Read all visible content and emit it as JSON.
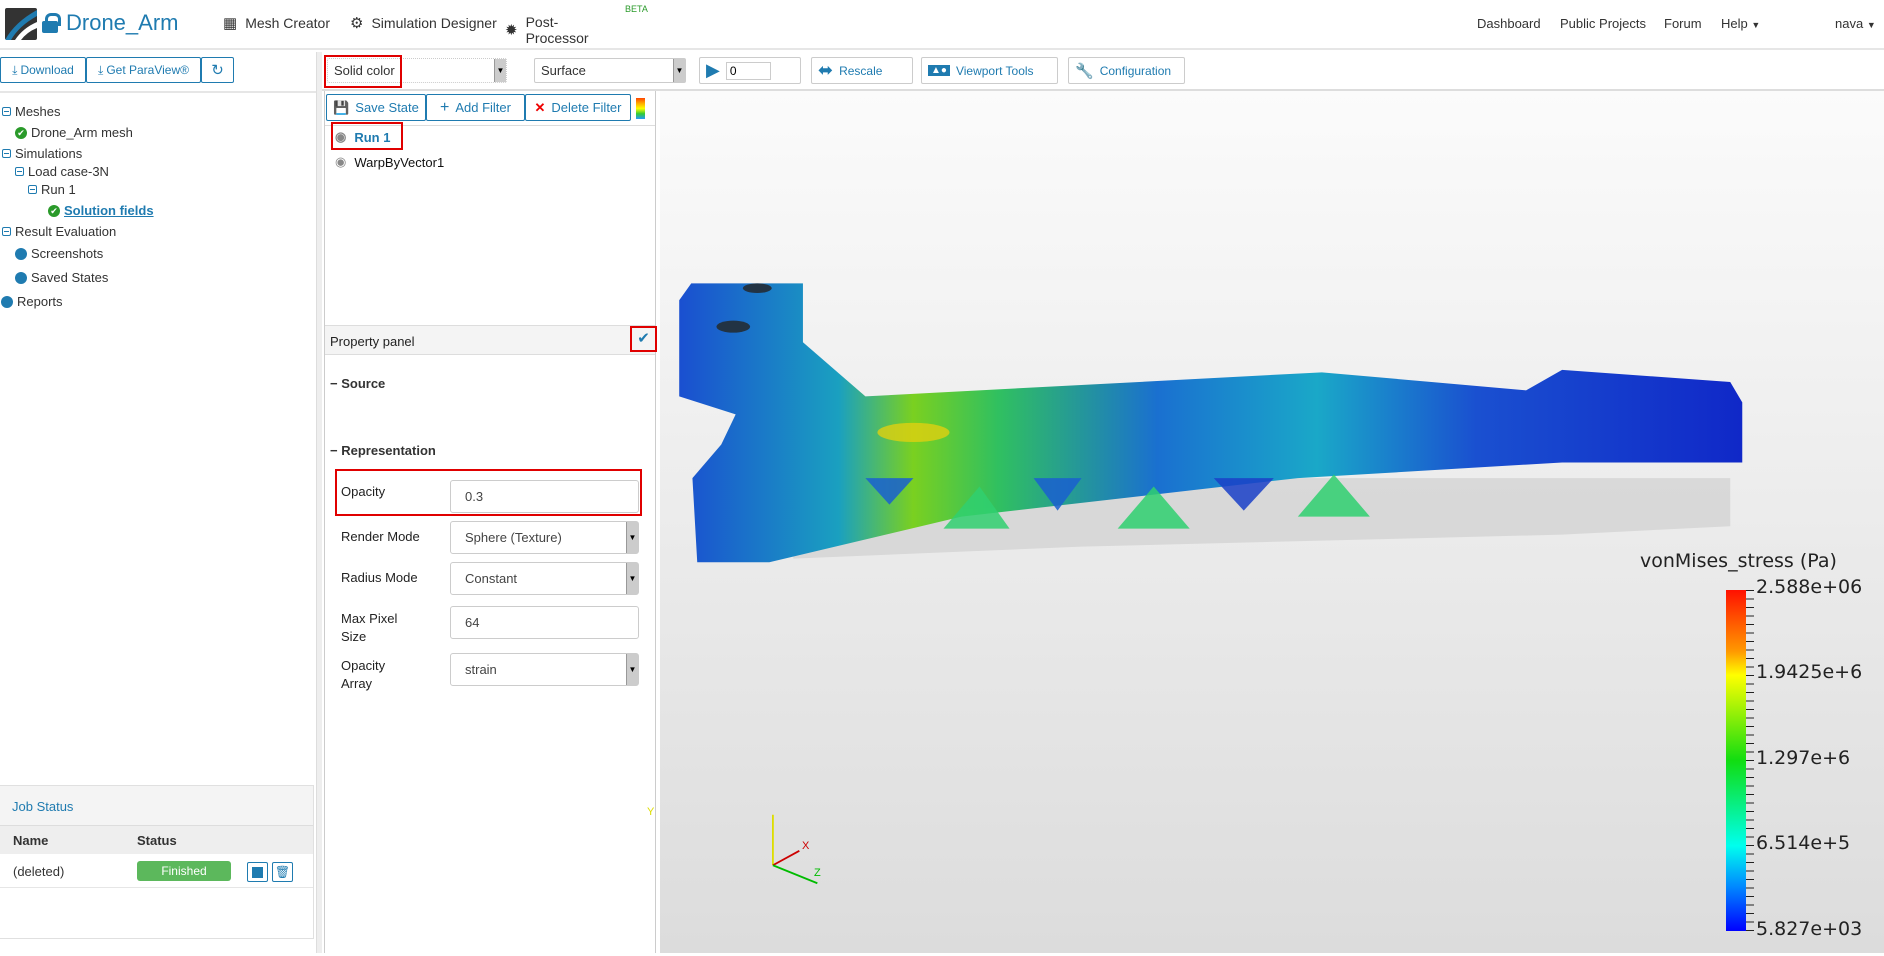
{
  "header": {
    "project_title": "Drone_Arm",
    "tabs": [
      {
        "label": "Mesh Creator",
        "icon": "grid-icon"
      },
      {
        "label": "Simulation Designer",
        "icon": "gears-icon"
      },
      {
        "label": "Post-Processor",
        "icon": "cog-icon",
        "active": true,
        "badge": "BETA"
      }
    ],
    "right_nav": [
      "Dashboard",
      "Public Projects",
      "Forum",
      "Help",
      "nava"
    ]
  },
  "sidebar": {
    "buttons": {
      "download": "Download",
      "get_paraview": "Get ParaView®"
    },
    "tree": {
      "meshes": "Meshes",
      "mesh_item": "Drone_Arm mesh",
      "simulations": "Simulations",
      "load_case": "Load case-3N",
      "run": "Run 1",
      "solution_fields": "Solution fields",
      "result_evaluation": "Result Evaluation",
      "screenshots": "Screenshots",
      "saved_states": "Saved States",
      "reports": "Reports"
    },
    "job_status": {
      "title": "Job Status",
      "columns": [
        "Name",
        "Status"
      ],
      "rows": [
        {
          "name": "(deleted)",
          "status": "Finished"
        }
      ]
    }
  },
  "toolbar": {
    "color_by": "Solid color",
    "representation": "Surface",
    "time_value": "0",
    "rescale": "Rescale",
    "viewport_tools": "Viewport Tools",
    "configuration": "Configuration"
  },
  "pipeline": {
    "save_state": "Save State",
    "add_filter": "Add Filter",
    "delete_filter": "Delete Filter",
    "items": [
      "Run 1",
      "WarpByVector1"
    ]
  },
  "properties": {
    "title": "Property panel",
    "source": "Source",
    "representation": "Representation",
    "fields": [
      {
        "label": "Opacity",
        "value": "0.3"
      },
      {
        "label": "Render Mode",
        "value": "Sphere (Texture)"
      },
      {
        "label": "Radius Mode",
        "value": "Constant"
      },
      {
        "label": "Max Pixel Size",
        "value": "64"
      },
      {
        "label": "Opacity Array",
        "value": "strain"
      }
    ]
  },
  "viewport": {
    "legend": {
      "title": "vonMises_stress (Pa)",
      "labels": [
        "2.588e+06",
        "1.9425e+6",
        "1.297e+6",
        "6.514e+5",
        "5.827e+03"
      ]
    },
    "axes": {
      "x": "X",
      "y": "Y",
      "z": "Z"
    }
  },
  "colors": {
    "accent": "#1f7bb0",
    "success": "#5cb85c",
    "highlight": "#e00000"
  }
}
